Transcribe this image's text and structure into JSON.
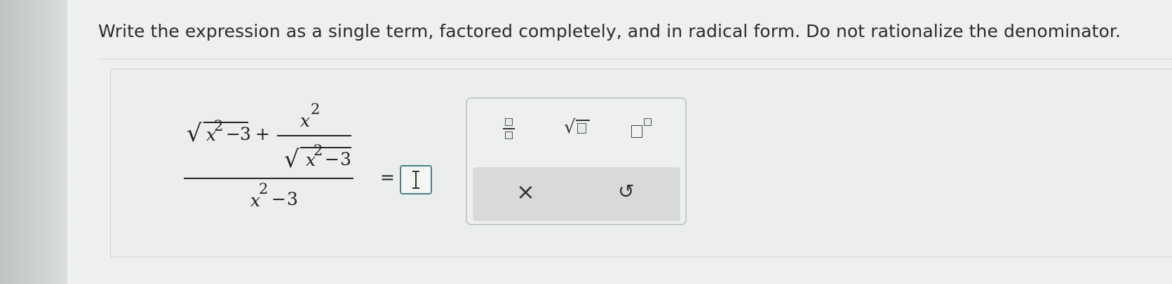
{
  "question": {
    "text": "Write the expression as a single term, factored completely, and in radical form. Do not rationalize the denominator."
  },
  "expression": {
    "x": "x",
    "exp": "2",
    "minus": "−",
    "three": "3",
    "plus": "+",
    "equals": "="
  },
  "palette": {
    "buttons": [
      {
        "name": "fraction",
        "icon": "fraction-icon"
      },
      {
        "name": "square-root",
        "icon": "square-root-icon"
      },
      {
        "name": "exponent",
        "icon": "exponent-icon"
      },
      {
        "name": "clear",
        "icon": "close-icon",
        "glyph": "×"
      },
      {
        "name": "undo",
        "icon": "undo-icon",
        "glyph": "↺"
      }
    ]
  },
  "colors": {
    "input_border": "#4a7f86",
    "palette_bottom": "#d7dad7"
  }
}
